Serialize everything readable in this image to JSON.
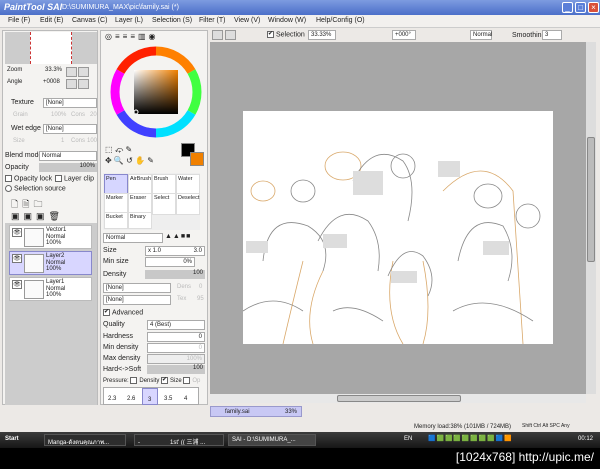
{
  "title": {
    "app": "PaintTool SAI",
    "path": "D:\\SUMIMURA_MAX\\pic\\family.sai (*)"
  },
  "menu": [
    "File (F)",
    "Edit (E)",
    "Canvas (C)",
    "Layer (L)",
    "Selection (S)",
    "Filter (T)",
    "View (V)",
    "Window (W)",
    "Help/Config (O)"
  ],
  "toolbar": {
    "selection": "Selection",
    "zoom": "33.33%",
    "angle": "+000°",
    "mode": "Normal",
    "smoothing_label": "Smoothing",
    "smoothing": "3"
  },
  "navigator": {
    "zoom_label": "Zoom",
    "zoom": "33.3%",
    "angle_label": "Angle",
    "angle": "+0008"
  },
  "texture": {
    "label": "Texture",
    "value": "[None]",
    "grain": "Grain",
    "grain_v": "100%",
    "cons": "Cons",
    "cons_v": "20"
  },
  "wetedge": {
    "label": "Wet edge",
    "value": "[None]",
    "size": "Size",
    "size_v": "1",
    "cons": "Cons",
    "cons_v": "100"
  },
  "blend": {
    "label": "Blend mode",
    "value": "Normal",
    "opacity_label": "Opacity",
    "opacity": "100%",
    "opacity_fraction": 1.0,
    "opacity_lock": "Opacity lock",
    "layer_clip": "Layer clip",
    "selection_source": "Selection source"
  },
  "layers": [
    {
      "name": "Vector1",
      "mode": "Normal",
      "opacity": "100%"
    },
    {
      "name": "Layer2",
      "mode": "Normal",
      "opacity": "100%"
    },
    {
      "name": "Layer1",
      "mode": "Normal",
      "opacity": "100%"
    }
  ],
  "brushes": [
    "Pen",
    "AirBrush",
    "Brush",
    "Water",
    "Marker",
    "Eraser",
    "Select",
    "Deselect",
    "Bucket",
    "Binary"
  ],
  "tool": {
    "mode": "Normal",
    "size_label": "Size",
    "size_mult": "x 1.0",
    "size": "3.0",
    "minsize_label": "Min size",
    "minsize": "0%",
    "density_label": "Density",
    "density": "100",
    "none1": "[None]",
    "dens": "Dens",
    "dens_v": "0",
    "none2": "[None]",
    "tex": "Tex",
    "tex_v": "95",
    "advanced": "Advanced",
    "quality_label": "Quality",
    "quality": "4 (Best)",
    "hardness_label": "Hardness",
    "hardness": "0",
    "mindens_label": "Min density",
    "mindens": "0",
    "maxdens_label": "Max density",
    "maxdens": "100%",
    "hardsoft_label": "Hard<->Soft",
    "hardsoft": "100",
    "pressure_label": "Pressure:",
    "p_density": "Density",
    "p_size": "Size",
    "p_op": "Op"
  },
  "brush_sizes": [
    "2.3",
    "2.6",
    "3",
    "3.5",
    "4"
  ],
  "colors": {
    "primary": "#000000",
    "secondary": "#f08000",
    "accent": "#d8d6ff"
  },
  "doc_tab": {
    "name": "family.sai",
    "zoom": "33%"
  },
  "status": {
    "memory": "Memory load:38% (101MB / 724MB)",
    "keys": [
      "Shift",
      "Ctrl",
      "Alt",
      "SPC",
      "Any"
    ]
  },
  "taskbar": {
    "start": "Start",
    "tasks": [
      "Manga-ดังตนคุณภาพ...",
      "-",
      "1st' (( 三浦 ...",
      "SAI - D:\\SUMIMURA_..."
    ],
    "lang": "EN",
    "clock": "00:12"
  },
  "watermark": "[1024x768] http://upic.me/"
}
